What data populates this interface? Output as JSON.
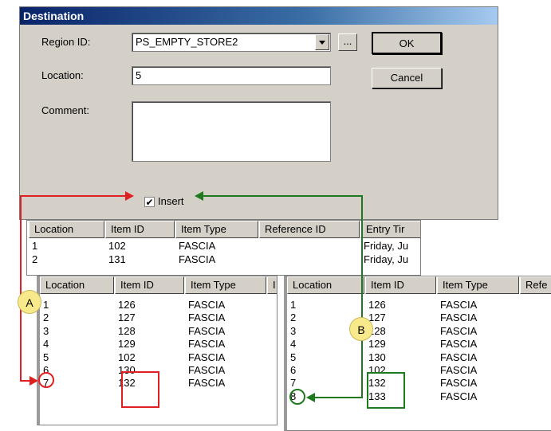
{
  "dialog": {
    "title": "Destination",
    "region_label": "Region ID:",
    "region_value": "PS_EMPTY_STORE2",
    "browse_label": "...",
    "location_label": "Location:",
    "location_value": "5",
    "comment_label": "Comment:",
    "comment_value": "",
    "ok_label": "OK",
    "cancel_label": "Cancel",
    "insert_label": "Insert",
    "insert_checked": "✔"
  },
  "back_grid": {
    "headers": [
      "Location",
      "Item ID",
      "Item Type",
      "Reference ID",
      "Entry Tir"
    ],
    "rows": [
      [
        "1",
        "102",
        "FASCIA",
        "",
        "Friday, Ju"
      ],
      [
        "2",
        "131",
        "FASCIA",
        "",
        "Friday, Ju"
      ]
    ]
  },
  "grid_a": {
    "headers": [
      "Location",
      "Item ID",
      "Item Type",
      "I"
    ],
    "rows": [
      [
        "1",
        "126",
        "FASCIA"
      ],
      [
        "2",
        "127",
        "FASCIA"
      ],
      [
        "3",
        "128",
        "FASCIA"
      ],
      [
        "4",
        "129",
        "FASCIA"
      ],
      [
        "5",
        "102",
        "FASCIA"
      ],
      [
        "6",
        "130",
        "FASCIA"
      ],
      [
        "7",
        "132",
        "FASCIA"
      ]
    ]
  },
  "grid_b": {
    "headers": [
      "Location",
      "Item ID",
      "Item Type",
      "Refe"
    ],
    "rows": [
      [
        "1",
        "126",
        "FASCIA"
      ],
      [
        "2",
        "127",
        "FASCIA"
      ],
      [
        "3",
        "128",
        "FASCIA"
      ],
      [
        "4",
        "129",
        "FASCIA"
      ],
      [
        "5",
        "130",
        "FASCIA"
      ],
      [
        "6",
        "102",
        "FASCIA"
      ],
      [
        "7",
        "132",
        "FASCIA"
      ],
      [
        "8",
        "133",
        "FASCIA"
      ]
    ]
  },
  "callouts": {
    "a": "A",
    "b": "B"
  },
  "colors": {
    "red_arrow": "#e02020",
    "green_arrow": "#1f7a1f",
    "callout_fill": "#f8e98a"
  },
  "icons": {
    "dropdown": "dropdown-arrow-icon",
    "check": "checkmark-icon"
  }
}
